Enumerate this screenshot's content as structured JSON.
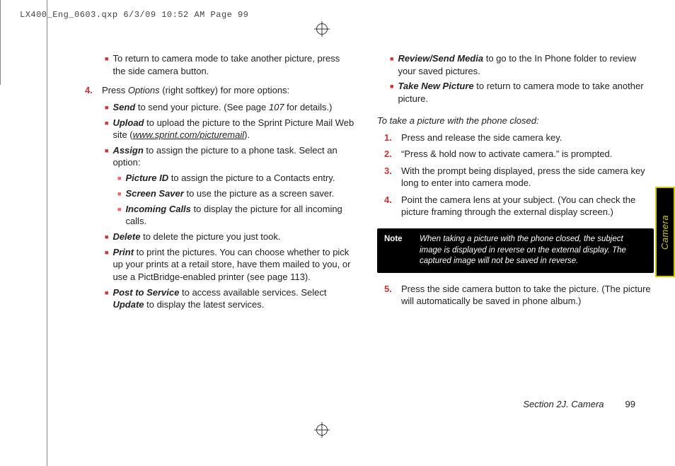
{
  "header": {
    "slug": "LX400_Eng_0603.qxp  6/3/09  10:52 AM  Page 99"
  },
  "sideTab": {
    "label": "Camera"
  },
  "footer": {
    "section": "Section 2J. Camera",
    "page": "99"
  },
  "left": {
    "returnToCamera": "To return to camera mode to take another picture, press the side camera button.",
    "step4num": "4.",
    "step4lead": "Press ",
    "step4ital": "Options",
    "step4rest": " (right softkey) for more options:",
    "sendLabel": "Send",
    "sendText1": " to send your picture. (See page ",
    "sendPage": "107",
    "sendText2": " for details.)",
    "uploadLabel": "Upload",
    "uploadText1": " to upload the picture to the Sprint Picture Mail Web site (",
    "uploadLink": "www.sprint.com/picturemail",
    "uploadText2": ").",
    "assignLabel": "Assign",
    "assignText": " to assign the picture to a phone task. Select an option:",
    "pidLabel": "Picture ID",
    "pidText": " to assign the picture to a Contacts entry.",
    "ssLabel": "Screen Saver",
    "ssText": " to use the picture as a screen saver.",
    "icLabel": "Incoming Calls",
    "icText": " to display the picture for all incoming calls.",
    "deleteLabel": "Delete",
    "deleteText": " to delete the picture you just took.",
    "printLabel": "Print",
    "printText": " to print the pictures. You can choose whether to pick up your prints at a retail store, have them mailed to you, or use a PictBridge-enabled printer (see page 113).",
    "ptsLabel": "Post to Service",
    "ptsText1": " to access available services. Select ",
    "ptsUpdate": "Update",
    "ptsText2": " to display the latest services."
  },
  "right": {
    "rsmLabel": "Review/Send Media",
    "rsmText": " to go to the In Phone folder to review your saved pictures.",
    "tnpLabel": "Take New Picture",
    "tnpText": " to return to camera mode to take another picture.",
    "subhead": "To take a picture with the phone closed:",
    "s1n": "1.",
    "s1": "Press and release the side camera key.",
    "s2n": "2.",
    "s2": "“Press & hold now to activate camera.” is prompted.",
    "s3n": "3.",
    "s3": "With the prompt being displayed, press the side camera key long to enter into camera mode.",
    "s4n": "4.",
    "s4": "Point the camera lens at your subject. (You can check the picture framing through the external display screen.)",
    "noteLabel": "Note",
    "noteText": "When taking a picture with the phone closed, the subject image is displayed in reverse on the external display. The captured image will not be saved in reverse.",
    "s5n": "5.",
    "s5": "Press the side camera button to take the picture. (The picture will automatically be saved in phone album.)"
  }
}
